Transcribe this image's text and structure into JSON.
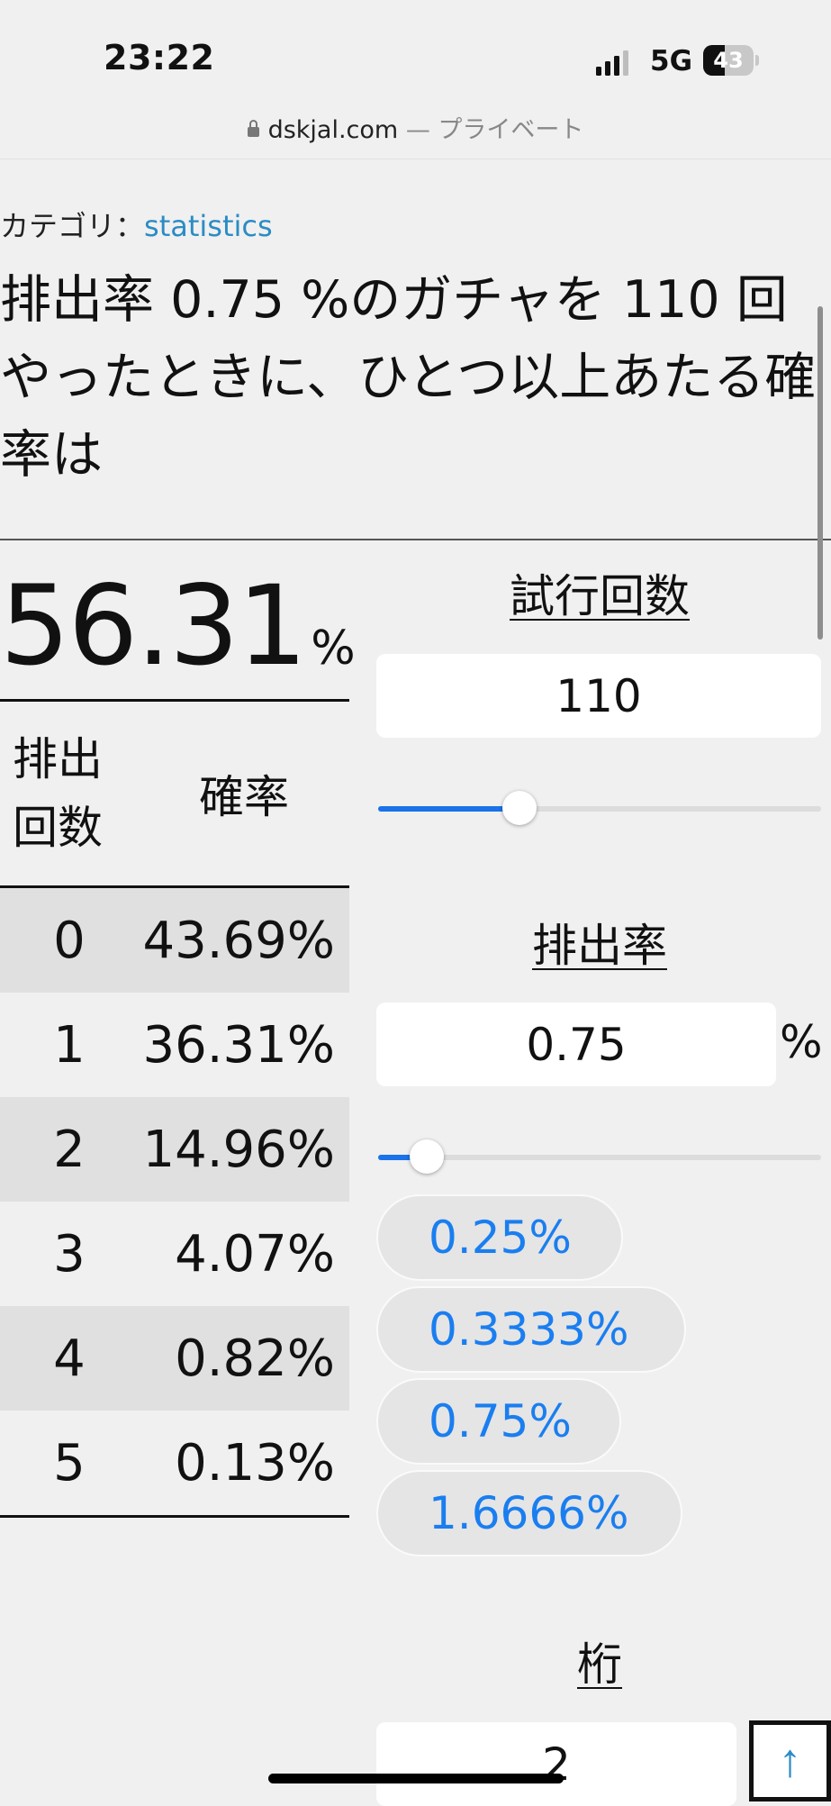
{
  "status_bar": {
    "time": "23:22",
    "network": "5G",
    "battery": "43",
    "battery_level": 0.43,
    "icons": [
      "signal-icon",
      "battery-icon"
    ]
  },
  "browser": {
    "domain": "dskjal.com",
    "privacy_suffix": "— プライベート",
    "lock_icon": "lock-icon"
  },
  "category": {
    "label": "カテゴリ：",
    "value": "statistics"
  },
  "title": "排出率 0.75 %のガチャを 110 回やったときに、ひとつ以上あたる確率は",
  "result": {
    "value": "56.31",
    "unit": "%"
  },
  "table": {
    "header_count": "排出回数",
    "header_prob": "確率",
    "rows": [
      {
        "count": "0",
        "prob": "43.69%"
      },
      {
        "count": "1",
        "prob": "36.31%"
      },
      {
        "count": "2",
        "prob": "14.96%"
      },
      {
        "count": "3",
        "prob": "4.07%"
      },
      {
        "count": "4",
        "prob": "0.82%"
      },
      {
        "count": "5",
        "prob": "0.13%"
      }
    ]
  },
  "trials": {
    "heading": "試行回数",
    "value": "110",
    "slider_fraction": 0.32
  },
  "rate": {
    "heading": "排出率",
    "value": "0.75",
    "unit": "%",
    "slider_fraction": 0.11,
    "presets": [
      "0.25%",
      "0.3333%",
      "0.75%",
      "1.6666%"
    ]
  },
  "digits": {
    "heading": "桁",
    "value": "2"
  },
  "scroll_top": {
    "label": "↑",
    "icon": "arrow-up-icon"
  },
  "colors": {
    "accent": "#1a73e8",
    "link": "#2b8cc4",
    "preset_text": "#1a7ef0",
    "background": "#f0f0f0",
    "row_shade": "#e0e0e0"
  }
}
